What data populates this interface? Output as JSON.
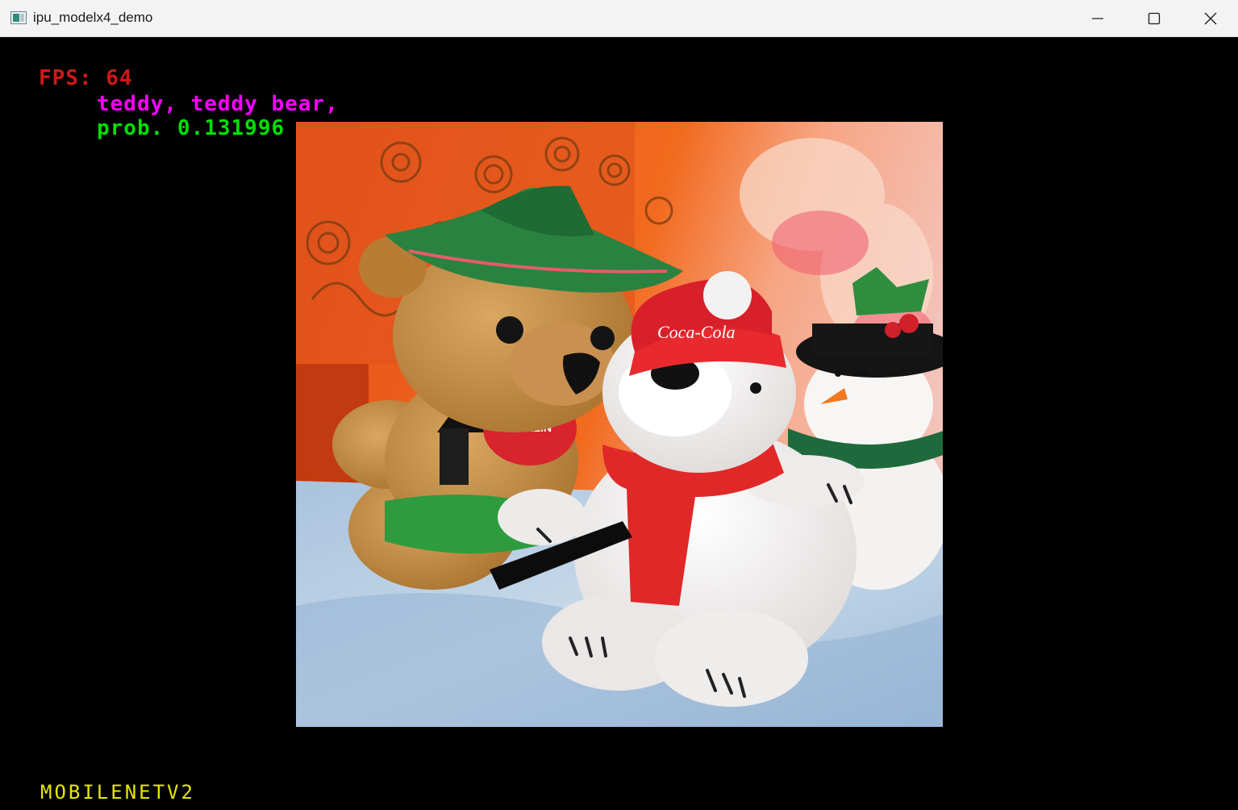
{
  "window": {
    "title": "ipu_modelx4_demo",
    "icon": "app-window-icon",
    "controls": {
      "minimize_icon": "minimize-icon",
      "maximize_icon": "maximize-icon",
      "close_icon": "close-icon"
    }
  },
  "overlay": {
    "fps_text": "FPS: 64",
    "label_text": "teddy, teddy bear,",
    "prob_text": "prob. 0.131996",
    "model_text": "MOBILENETV2",
    "colors": {
      "fps": "#d01818",
      "label": "#ff00ff",
      "prob": "#00e000",
      "model": "#e6e600"
    }
  },
  "image": {
    "subject": "stuffed-animals-photo",
    "hat_text": "Coca-Cola",
    "heart_text": "BERLIN"
  }
}
